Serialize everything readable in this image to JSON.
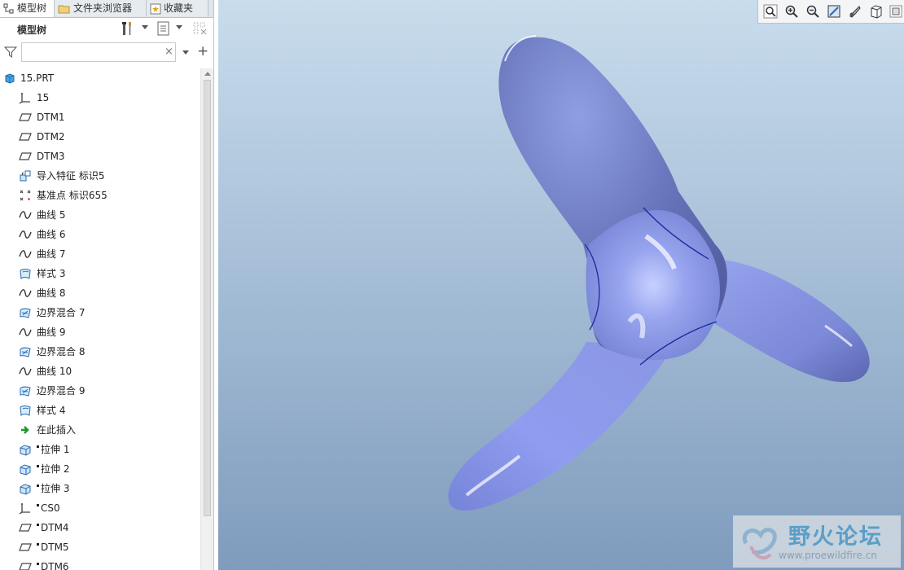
{
  "tabs": [
    {
      "label": "模型树",
      "icon": "model-tree-icon",
      "active": true
    },
    {
      "label": "文件夹浏览器",
      "icon": "folder-icon",
      "active": false
    },
    {
      "label": "收藏夹",
      "icon": "favorites-icon",
      "active": false
    }
  ],
  "toolbar": {
    "title": "模型树",
    "settings_icon": "tools-icon",
    "show_icon": "list-icon",
    "columns_icon": "columns-icon"
  },
  "search": {
    "placeholder": "",
    "value": ""
  },
  "tree": {
    "root": "15.PRT",
    "items": [
      {
        "icon": "csys-icon",
        "label": "15",
        "marker": false
      },
      {
        "icon": "plane-icon",
        "label": "DTM1",
        "marker": false
      },
      {
        "icon": "plane-icon",
        "label": "DTM2",
        "marker": false
      },
      {
        "icon": "plane-icon",
        "label": "DTM3",
        "marker": false
      },
      {
        "icon": "import-feature-icon",
        "label": "导入特征 标识5",
        "marker": false
      },
      {
        "icon": "datum-point-icon",
        "label": "基准点 标识655",
        "marker": false
      },
      {
        "icon": "curve-icon",
        "label": "曲线 5",
        "marker": false
      },
      {
        "icon": "curve-icon",
        "label": "曲线 6",
        "marker": false
      },
      {
        "icon": "curve-icon",
        "label": "曲线 7",
        "marker": false
      },
      {
        "icon": "style-icon",
        "label": "样式 3",
        "marker": false
      },
      {
        "icon": "curve-icon",
        "label": "曲线 8",
        "marker": false
      },
      {
        "icon": "boundary-blend-icon",
        "label": "边界混合 7",
        "marker": false
      },
      {
        "icon": "curve-icon",
        "label": "曲线 9",
        "marker": false
      },
      {
        "icon": "boundary-blend-icon",
        "label": "边界混合 8",
        "marker": false
      },
      {
        "icon": "curve-icon",
        "label": "曲线 10",
        "marker": false
      },
      {
        "icon": "boundary-blend-icon",
        "label": "边界混合 9",
        "marker": false
      },
      {
        "icon": "style-icon",
        "label": "样式 4",
        "marker": false
      },
      {
        "icon": "insert-here-icon",
        "label": "在此插入",
        "marker": false
      },
      {
        "icon": "extrude-icon",
        "label": "拉伸 1",
        "marker": true
      },
      {
        "icon": "extrude-icon",
        "label": "拉伸 2",
        "marker": true
      },
      {
        "icon": "extrude-icon",
        "label": "拉伸 3",
        "marker": true
      },
      {
        "icon": "csys-icon",
        "label": "CS0",
        "marker": true
      },
      {
        "icon": "plane-icon",
        "label": "DTM4",
        "marker": true
      },
      {
        "icon": "plane-icon",
        "label": "DTM5",
        "marker": true
      },
      {
        "icon": "plane-icon",
        "label": "DTM6",
        "marker": true
      }
    ]
  },
  "viewport_toolbar": [
    "refit-icon",
    "zoom-in-icon",
    "zoom-out-icon",
    "repaint-icon",
    "view-manager-icon",
    "display-style-icon",
    "saved-views-icon"
  ],
  "watermark": {
    "title": "野火论坛",
    "url": "www.proewildfire.cn"
  },
  "colors": {
    "model": "#8c9be6",
    "viewport_top": "#c8dcec",
    "viewport_bottom": "#7f9bbd",
    "panel_bg": "#ffffff"
  }
}
